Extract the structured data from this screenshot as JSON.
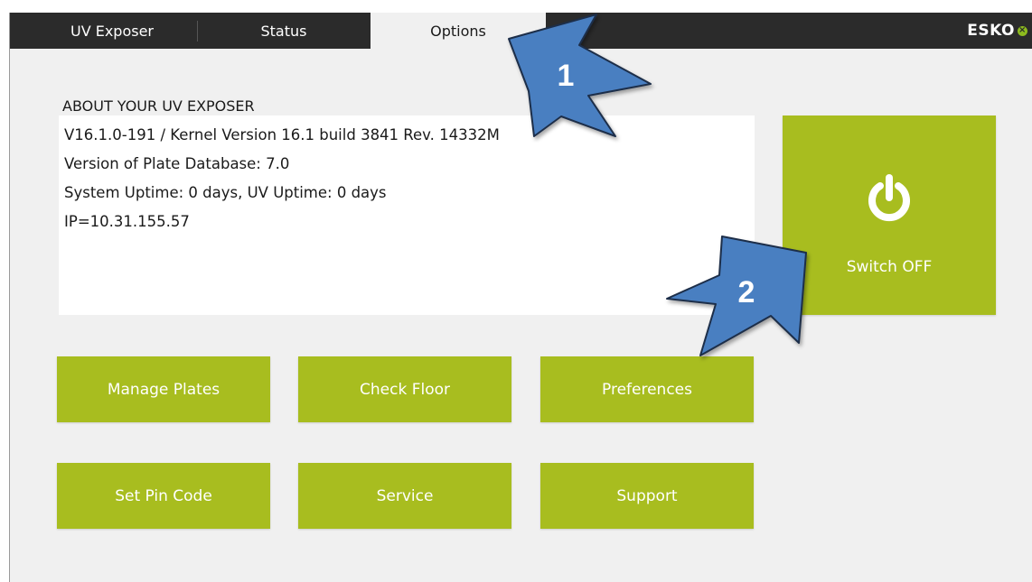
{
  "tabs": [
    {
      "label": "UV Exposer",
      "active": false
    },
    {
      "label": "Status",
      "active": false
    },
    {
      "label": "Options",
      "active": true
    }
  ],
  "brand": {
    "name": "ESKO"
  },
  "about": {
    "title": "ABOUT YOUR UV EXPOSER",
    "lines": [
      "V16.1.0-191 / Kernel Version 16.1 build 3841 Rev. 14332M",
      "Version of Plate Database: 7.0",
      "System Uptime: 0 days, UV Uptime: 0 days",
      "IP=10.31.155.57"
    ]
  },
  "power": {
    "label": "Switch OFF",
    "icon": "power-icon"
  },
  "buttons": [
    {
      "label": "Manage Plates"
    },
    {
      "label": "Check Floor"
    },
    {
      "label": "Preferences"
    },
    {
      "label": "Set Pin Code"
    },
    {
      "label": "Service"
    },
    {
      "label": "Support"
    }
  ],
  "callouts": [
    {
      "number": "1"
    },
    {
      "number": "2"
    }
  ],
  "colors": {
    "accent_green": "#a8bd1f",
    "topbar": "#2b2b2b",
    "panel": "#f0f0f0",
    "callout_blue": "#4a7fc1"
  }
}
